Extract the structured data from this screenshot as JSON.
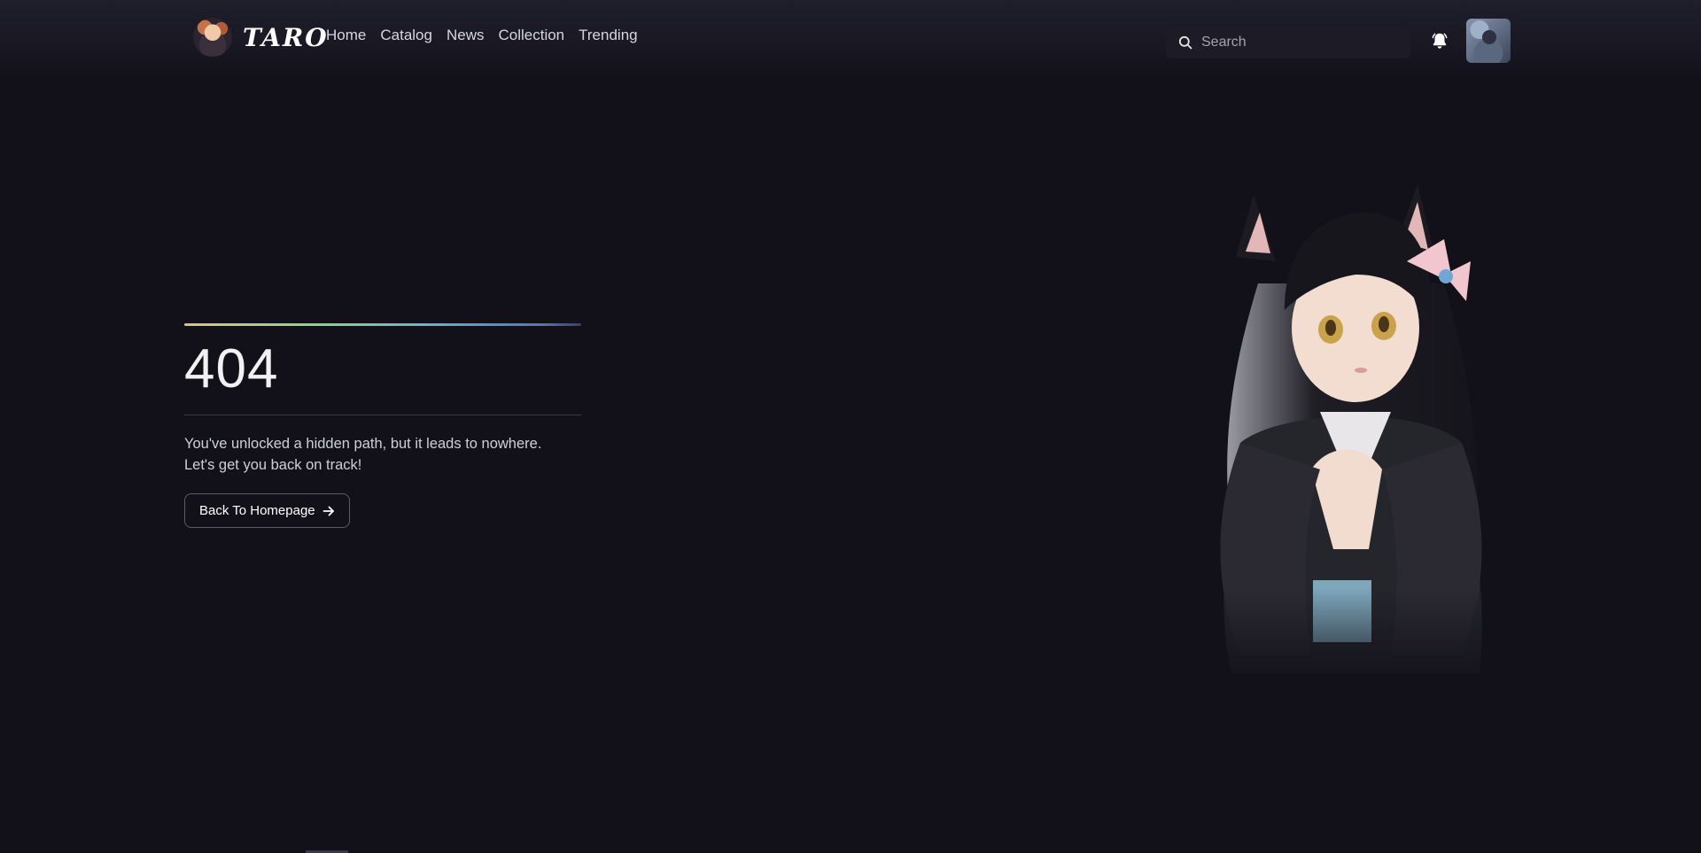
{
  "header": {
    "logo_text": "TARO",
    "nav": [
      {
        "label": "Home"
      },
      {
        "label": "Catalog"
      },
      {
        "label": "News"
      },
      {
        "label": "Collection"
      },
      {
        "label": "Trending"
      }
    ],
    "search": {
      "placeholder": "Search",
      "icon": "search-icon"
    },
    "notification_icon": "bell-icon"
  },
  "error": {
    "code": "404",
    "message_line1": "You've unlocked a hidden path, but it leads to nowhere.",
    "message_line2": "Let's get you back on track!",
    "button_label": "Back To Homepage",
    "button_icon": "arrow-right-icon"
  },
  "colors": {
    "background": "#12111a",
    "accent_gradient": [
      "#d8c96c",
      "#8fcf93",
      "#5fbcc4",
      "#5b72b8"
    ]
  }
}
